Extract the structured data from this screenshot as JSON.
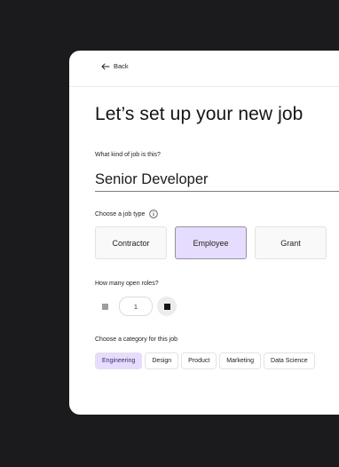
{
  "nav": {
    "back_label": "Back"
  },
  "page": {
    "title": "Let’s set up your new job"
  },
  "job_name": {
    "label": "What kind of job is this?",
    "value": "Senior Developer"
  },
  "job_type": {
    "label": "Choose a job type",
    "options": [
      "Contractor",
      "Employee",
      "Grant"
    ],
    "selected": "Employee"
  },
  "open_roles": {
    "label": "How many open roles?",
    "value": "1"
  },
  "category": {
    "label": "Choose a category for this job",
    "options": [
      "Engineering",
      "Design",
      "Product",
      "Marketing",
      "Data Science"
    ],
    "selected": "Engineering"
  },
  "colors": {
    "background": "#1b1a1c",
    "card": "#ffffff",
    "selected_fill": "#e6dcfd",
    "selected_border": "#9b84d8"
  }
}
